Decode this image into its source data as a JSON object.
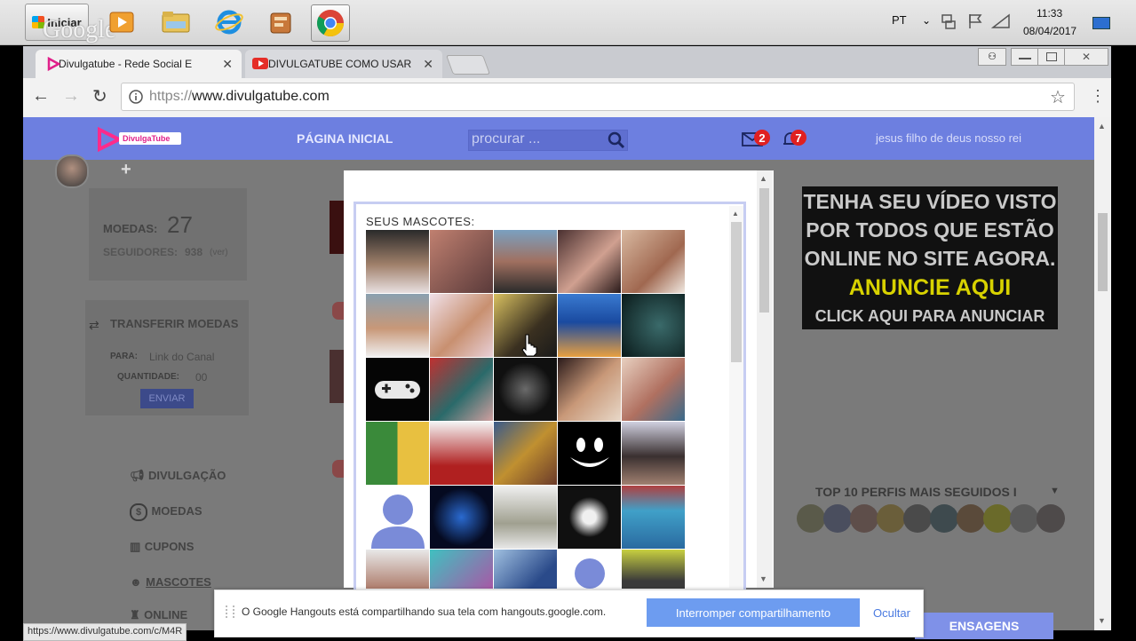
{
  "taskbar": {
    "start_label": "Iniciar",
    "watermark": "Google",
    "lang": "PT",
    "time": "11:33",
    "date": "08/04/2017"
  },
  "browser": {
    "tabs": [
      {
        "label": "Divulgatube - Rede Social E",
        "icon": "divulgatube-play-icon",
        "active": true
      },
      {
        "label": "DIVULGATUBE COMO USAR",
        "icon": "youtube-icon",
        "active": false
      }
    ],
    "url_prefix": "https://",
    "url_host": "www.divulgatube.com",
    "status_url": "https://www.divulgatube.com/c/M4R"
  },
  "site": {
    "logo_text": "DivulgaTube",
    "nav_home": "PÁGINA INICIAL",
    "search_placeholder": "procurar ...",
    "messages_count": "2",
    "notifications_count": "7",
    "user_name": "jesus filho de deus nosso rei",
    "plus": "+",
    "coins_label": "MOEDAS:",
    "coins_value": "27",
    "followers_label": "SEGUIDORES:",
    "followers_value": "938",
    "followers_suffix": "(ver)",
    "transfer_title": "TRANSFERIR MOEDAS",
    "to_label": "PARA:",
    "to_placeholder": "Link do Canal",
    "qty_label": "QUANTIDADE:",
    "qty_value": "00",
    "send_label": "ENVIAR",
    "menu": [
      {
        "label": "DIVULGAÇÃO",
        "icon": "megaphone-icon"
      },
      {
        "label": "MOEDAS",
        "icon": "coin-icon"
      },
      {
        "label": "CUPONS",
        "icon": "barcode-icon"
      },
      {
        "label": "MASCOTES",
        "icon": "mascot-icon"
      },
      {
        "label": "ONLINE",
        "icon": "person-icon"
      }
    ],
    "top10_title": "TOP 10 PERFIS MAIS SEGUIDOS I",
    "messages_button": "ENSAGENS"
  },
  "modal": {
    "title": "SEUS MASCOTES:"
  },
  "ad": {
    "lines": [
      "TENHA SEU VÍDEO VISTO",
      "POR TODOS QUE ESTÃO",
      "ONLINE NO SITE AGORA.",
      "ANUNCIE AQUI",
      "CLICK AQUI PARA ANUNCIAR"
    ],
    "highlight_color": "#e8e200"
  },
  "hangouts": {
    "message": "O Google Hangouts está compartilhando sua tela com hangouts.google.com.",
    "stop_label": "Interromper compartilhamento",
    "hide_label": "Ocultar"
  },
  "colors": {
    "nav_bar": "#6d7fe0",
    "badge": "#e02020",
    "accent_button": "#6d9cf0"
  }
}
